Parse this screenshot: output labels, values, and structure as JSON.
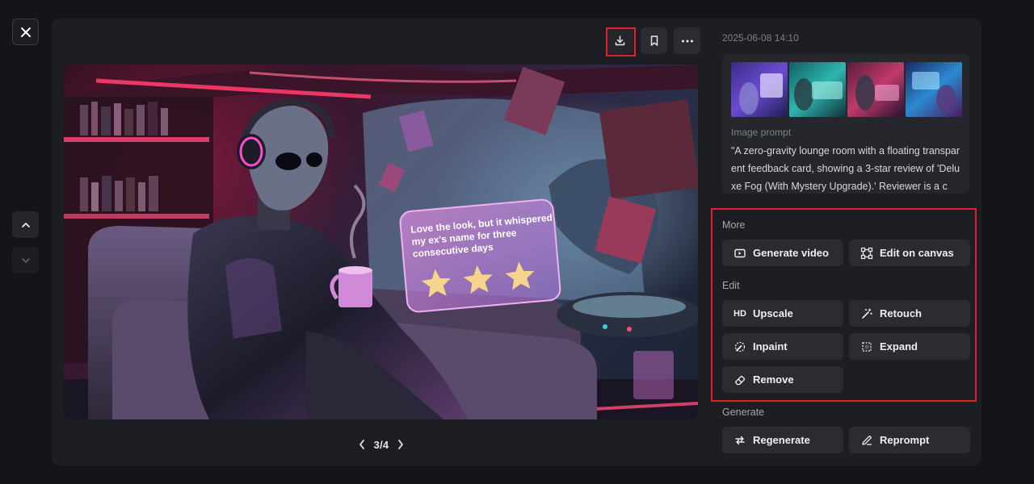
{
  "toolbar": {
    "close_icon": "close-icon",
    "download_icon": "download-icon",
    "bookmark_icon": "bookmark-icon",
    "more_icon": "more-horizontal-icon"
  },
  "nav": {
    "up_icon": "chevron-up-icon",
    "down_icon": "chevron-down-icon"
  },
  "artwork": {
    "card_text": "Love the look, but it whispered my ex's name for three consecutive days",
    "card_text_line1": "Love the look, but it whispered",
    "card_text_line2": "my ex's name for three",
    "card_text_line3": "consecutive days",
    "stars": 3
  },
  "pager": {
    "current": "3/4"
  },
  "details": {
    "date": "2025-06-08 14:10",
    "prompt_label": "Image prompt",
    "prompt_text": "\"A zero-gravity lounge room with a floating transparent feedback card, showing a 3-star review of 'Deluxe Fog (With Mystery Upgrade).' Reviewer is a c"
  },
  "more": {
    "label": "More",
    "generate_video": "Generate video",
    "edit_on_canvas": "Edit on canvas"
  },
  "edit": {
    "label": "Edit",
    "upscale": "Upscale",
    "upscale_glyph": "HD",
    "retouch": "Retouch",
    "inpaint": "Inpaint",
    "expand": "Expand",
    "remove": "Remove"
  },
  "generate": {
    "label": "Generate",
    "regenerate": "Regenerate",
    "reprompt": "Reprompt"
  },
  "colors": {
    "highlight": "#e3202e",
    "panel": "#1d1e23",
    "button": "#2a2c32"
  }
}
